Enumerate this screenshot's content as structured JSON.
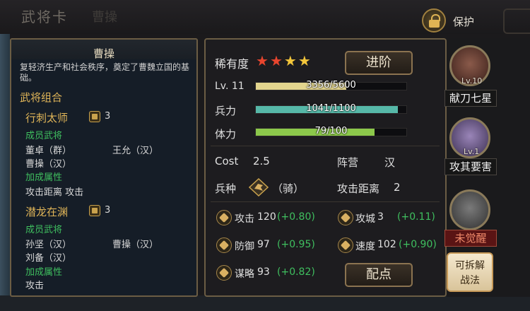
{
  "header": {
    "title": "武将卡",
    "subtitle": "曹操",
    "protect_label": "保护"
  },
  "left_panel": {
    "name": "曹操",
    "description": "复轻济生产和社会秩序，奠定了曹魏立国的基础。",
    "combos_heading": "武将组合",
    "combos": [
      {
        "name": "行刺太师",
        "count": "3",
        "members_heading": "成员武将",
        "members": [
          "董卓（群）",
          "王允（汉）",
          "曹操（汉）"
        ],
        "bonus_heading": "加成属性",
        "bonus": "攻击距离  攻击"
      },
      {
        "name": "潜龙在渊",
        "count": "3",
        "members_heading": "成员武将",
        "members": [
          "孙坚（汉）",
          "曹操（汉）",
          "刘备（汉）"
        ],
        "bonus_heading": "加成属性",
        "bonus": "攻击"
      }
    ]
  },
  "right_panel": {
    "rarity_label": "稀有度",
    "rarity_stars": 4,
    "colors": {
      "star_red": "#e8452e",
      "star_gold": "#f3c63b",
      "bar_level": "#e3d58e",
      "bar_troops": "#56b8a8",
      "bar_stamina": "#8cc84b"
    },
    "advance_button": "进阶",
    "level": {
      "label": "Lv. 11",
      "text": "3356/5600",
      "fraction": 0.6
    },
    "troops": {
      "label": "兵力",
      "text": "1041/1100",
      "fraction": 0.946
    },
    "stamina": {
      "label": "体力",
      "text": "79/100",
      "fraction": 0.79
    },
    "cost_label": "Cost",
    "cost_value": "2.5",
    "camp_label": "阵营",
    "camp_value": "汉",
    "unit_type_label": "兵种",
    "unit_type_value": "（骑）",
    "range_label": "攻击距离",
    "range_value": "2",
    "attack": {
      "label": "攻击",
      "value": "120",
      "bonus": "(+0.80)"
    },
    "siege": {
      "label": "攻城",
      "value": "3",
      "bonus": "(+0.11)"
    },
    "defense": {
      "label": "防御",
      "value": "97",
      "bonus": "(+0.95)"
    },
    "speed": {
      "label": "速度",
      "value": "102",
      "bonus": "(+0.90)"
    },
    "strategy": {
      "label": "谋略",
      "value": "93",
      "bonus": "(+0.82)"
    },
    "allocate_button": "配点"
  },
  "skills": [
    {
      "level": "Lv.10",
      "name": "献刀七星"
    },
    {
      "level": "Lv.1",
      "name": "攻其要害"
    },
    {
      "level": "",
      "name": "未觉醒"
    }
  ],
  "dismantle_button_line1": "可拆解",
  "dismantle_button_line2": "战法"
}
